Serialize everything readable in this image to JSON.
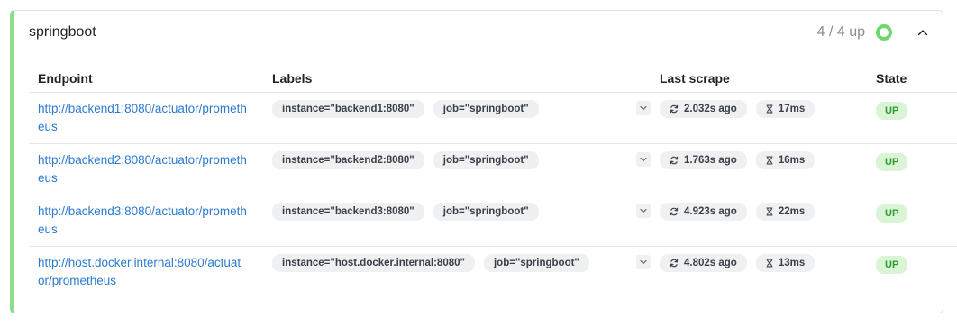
{
  "pool": {
    "name": "springboot",
    "up_count": "4 / 4 up",
    "health_color": "#6fd56c",
    "accent_color": "#8fdc8a"
  },
  "columns": {
    "endpoint": "Endpoint",
    "labels": "Labels",
    "last_scrape": "Last scrape",
    "state": "State"
  },
  "targets": [
    {
      "endpoint": "http://backend1:8080/actuator/prometheus",
      "labels": [
        "instance=\"backend1:8080\"",
        "job=\"springboot\""
      ],
      "last_scrape": "2.032s ago",
      "duration": "17ms",
      "state": "UP"
    },
    {
      "endpoint": "http://backend2:8080/actuator/prometheus",
      "labels": [
        "instance=\"backend2:8080\"",
        "job=\"springboot\""
      ],
      "last_scrape": "1.763s ago",
      "duration": "16ms",
      "state": "UP"
    },
    {
      "endpoint": "http://backend3:8080/actuator/prometheus",
      "labels": [
        "instance=\"backend3:8080\"",
        "job=\"springboot\""
      ],
      "last_scrape": "4.923s ago",
      "duration": "22ms",
      "state": "UP"
    },
    {
      "endpoint": "http://host.docker.internal:8080/actuator/prometheus",
      "labels": [
        "instance=\"host.docker.internal:8080\"",
        "job=\"springboot\""
      ],
      "last_scrape": "4.802s ago",
      "duration": "13ms",
      "state": "UP"
    }
  ],
  "icons": {
    "collapse": "chevron-up-icon",
    "expand": "chevron-down-icon",
    "last_scrape": "refresh-icon",
    "duration": "hourglass-icon",
    "health": "status-ring-icon"
  }
}
